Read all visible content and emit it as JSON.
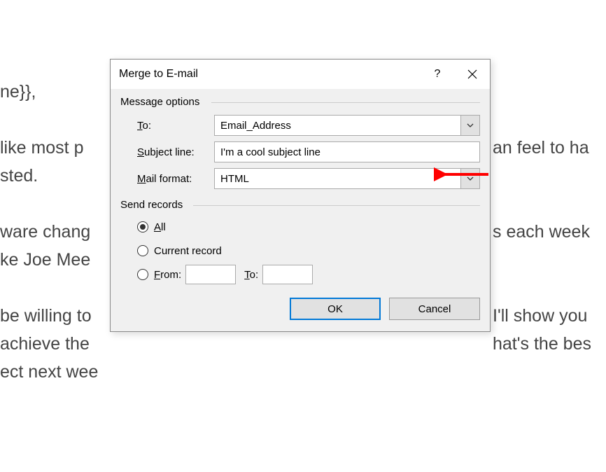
{
  "background": {
    "line1": "ne}},",
    "line2a": " like most p",
    "line2b": "an feel to ha",
    "line3": "sted.",
    "line4a": "ware chang",
    "line4b": "s each week",
    "line5": "ke Joe Mee",
    "line6a": "be willing to",
    "line6b": "I'll show you",
    "line7a": " achieve the",
    "line7b": "hat's the bes",
    "line8": "ect next wee"
  },
  "dialog": {
    "title": "Merge to E-mail",
    "section_message": "Message options",
    "labels": {
      "to": "o:",
      "to_prefix": "T",
      "subject": "ubject line:",
      "subject_prefix": "S",
      "mail": "ail format:",
      "mail_prefix": "M"
    },
    "to_value": "Email_Address",
    "subject_value": "I'm a cool subject line",
    "mail_value": "HTML",
    "section_send": "Send records",
    "radio_all": "ll",
    "radio_all_prefix": "A",
    "radio_current": "Current record",
    "radio_from": "rom:",
    "radio_from_prefix": "F",
    "from_value": "",
    "to_small_label": "o:",
    "to_small_prefix": "T",
    "to_value_small": "",
    "ok": "OK",
    "cancel": "Cancel"
  }
}
